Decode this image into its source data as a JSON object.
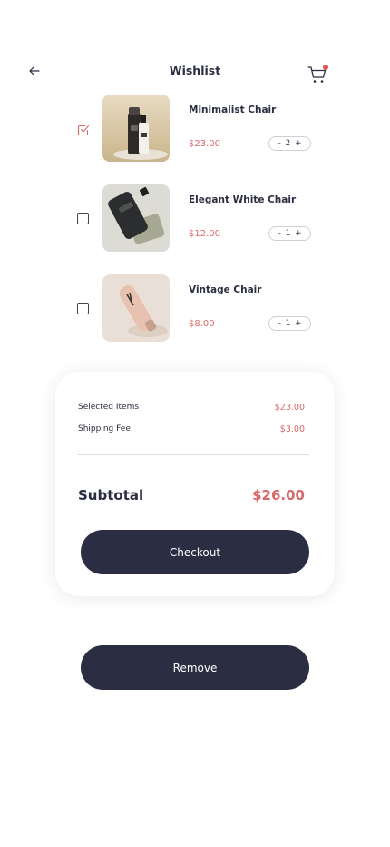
{
  "header": {
    "title": "Wishlist"
  },
  "items": [
    {
      "name": "Minimalist Chair",
      "price": "$23.00",
      "quantity": "2",
      "checked": true
    },
    {
      "name": "Elegant White Chair",
      "price": "$12.00",
      "quantity": "1",
      "checked": false
    },
    {
      "name": "Vintage Chair",
      "price": "$8.00",
      "quantity": "1",
      "checked": false
    }
  ],
  "stepper": {
    "minus": "-",
    "plus": "+"
  },
  "summary": {
    "selected_label": "Selected Items",
    "selected_value": "$23.00",
    "shipping_label": "Shipping Fee",
    "shipping_value": "$3.00",
    "subtotal_label": "Subtotal",
    "subtotal_value": "$26.00",
    "checkout_label": "Checkout"
  },
  "remove_label": "Remove",
  "colors": {
    "accent": "#d8696a",
    "dark": "#2b2e43",
    "badge": "#e2574c"
  }
}
